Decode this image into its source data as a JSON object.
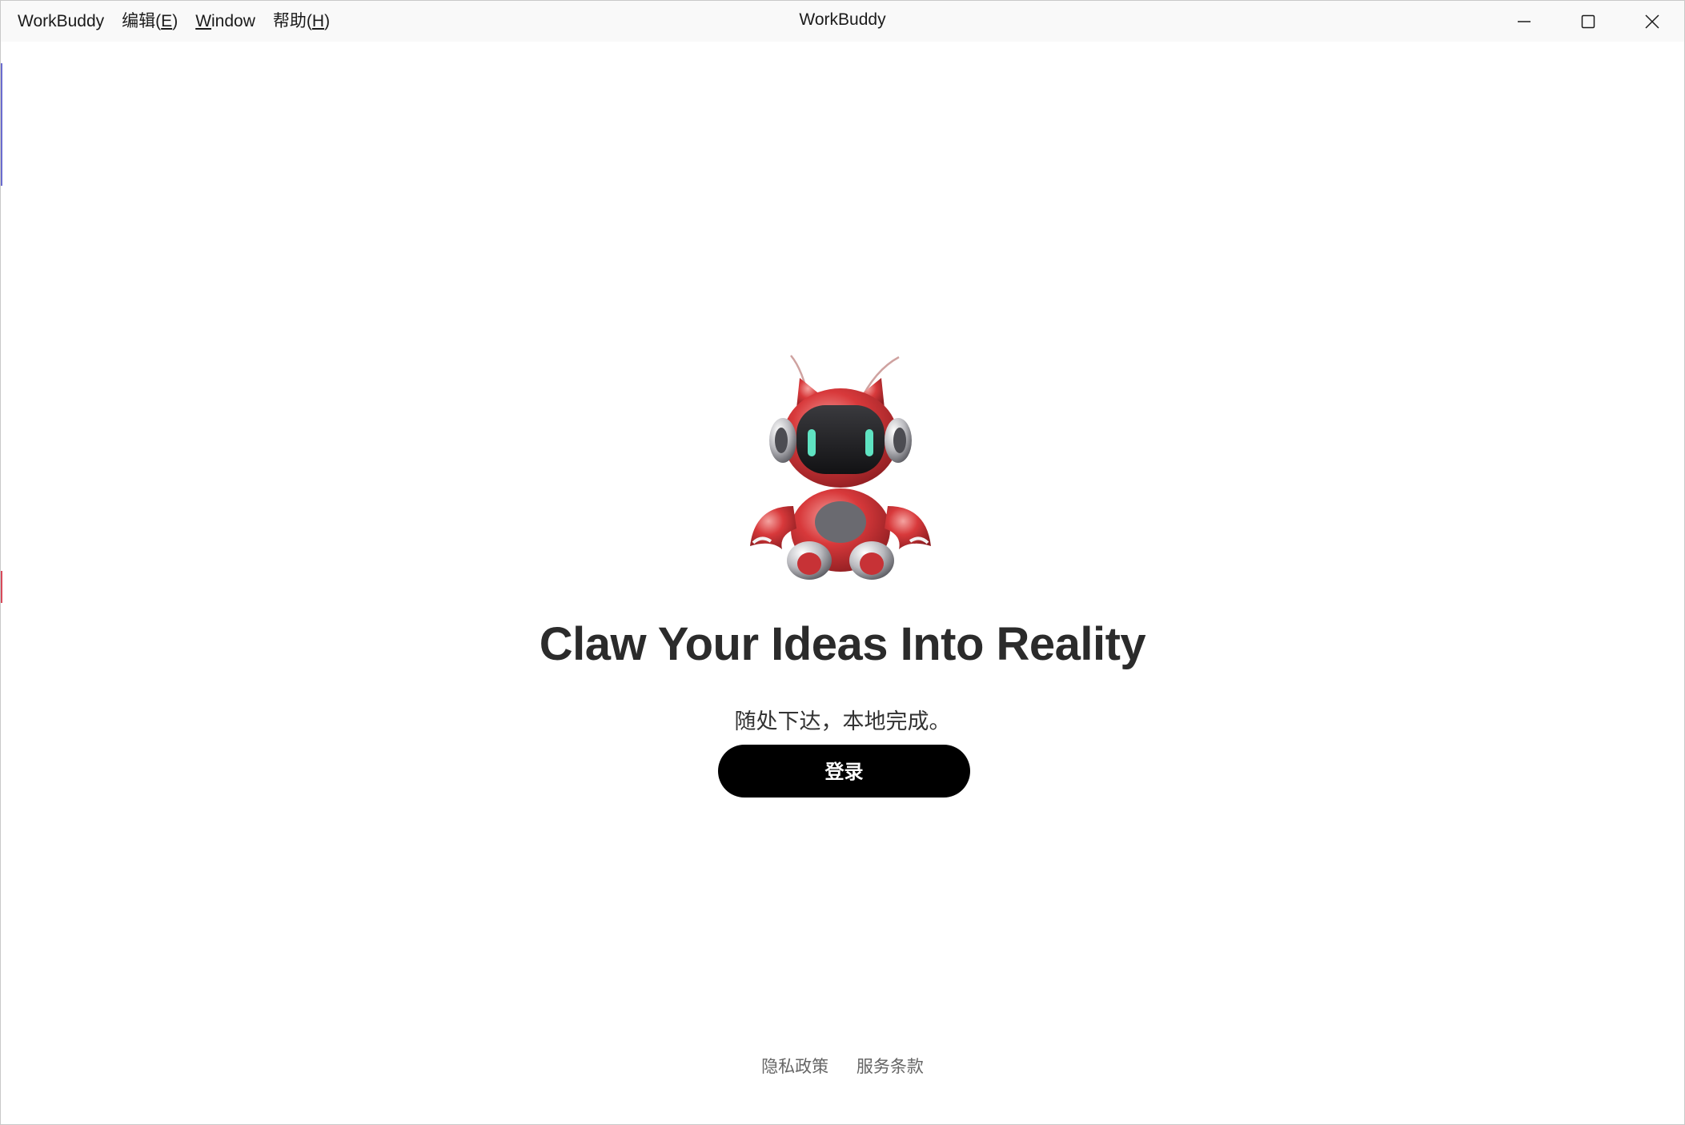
{
  "app": {
    "window_title": "WorkBuddy"
  },
  "menu": {
    "items": [
      {
        "label": "WorkBuddy"
      },
      {
        "label": "编辑(",
        "mnemonic": "E",
        "suffix": ")"
      },
      {
        "label": "",
        "mnemonic": "W",
        "suffix": "indow"
      },
      {
        "label": "帮助(",
        "mnemonic": "H",
        "suffix": ")"
      }
    ]
  },
  "window_controls": {
    "minimize_icon": "minimize-icon",
    "maximize_icon": "maximize-icon",
    "close_icon": "close-icon"
  },
  "hero": {
    "mascot_icon": "robot-crab-mascot",
    "headline": "Claw Your Ideas Into Reality",
    "subtitle": "随处下达，本地完成。",
    "login_label": "登录"
  },
  "footer": {
    "privacy_label": "隐私政策",
    "terms_label": "服务条款"
  },
  "colors": {
    "button_bg": "#000000",
    "button_text": "#ffffff",
    "headline": "#2b2b2b",
    "titlebar_bg": "#f9f9f9",
    "mascot_red": "#d8393b",
    "mascot_eye": "#5fe3c2"
  }
}
